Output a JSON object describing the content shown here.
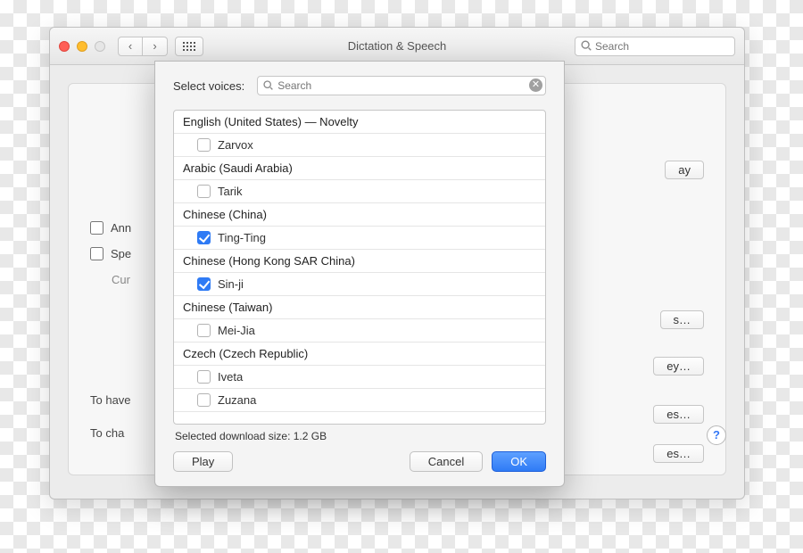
{
  "window": {
    "title": "Dictation & Speech",
    "search_placeholder": "Search"
  },
  "background": {
    "checkbox1_label": "Ann",
    "checkbox2_label": "Spe",
    "cur_label": "Cur",
    "line1": "To have",
    "line2": "To cha",
    "btn_play": "ay",
    "btn_s1": "s…",
    "btn_ey": "ey…",
    "btn_es1": "es…",
    "btn_es2": "es…",
    "help": "?"
  },
  "sheet": {
    "title": "Select voices:",
    "search_placeholder": "Search",
    "download_label": "Selected download size: 1.2 GB",
    "play": "Play",
    "cancel": "Cancel",
    "ok": "OK"
  },
  "voices": [
    {
      "type": "group",
      "label": "English (United States) — Novelty"
    },
    {
      "type": "voice",
      "label": "Zarvox",
      "checked": false
    },
    {
      "type": "group",
      "label": "Arabic (Saudi Arabia)"
    },
    {
      "type": "voice",
      "label": "Tarik",
      "checked": false
    },
    {
      "type": "group",
      "label": "Chinese (China)"
    },
    {
      "type": "voice",
      "label": "Ting-Ting",
      "checked": true
    },
    {
      "type": "group",
      "label": "Chinese (Hong Kong SAR China)"
    },
    {
      "type": "voice",
      "label": "Sin-ji",
      "checked": true
    },
    {
      "type": "group",
      "label": "Chinese (Taiwan)"
    },
    {
      "type": "voice",
      "label": "Mei-Jia",
      "checked": false
    },
    {
      "type": "group",
      "label": "Czech (Czech Republic)"
    },
    {
      "type": "voice",
      "label": "Iveta",
      "checked": false
    },
    {
      "type": "voice",
      "label": "Zuzana",
      "checked": false
    }
  ]
}
